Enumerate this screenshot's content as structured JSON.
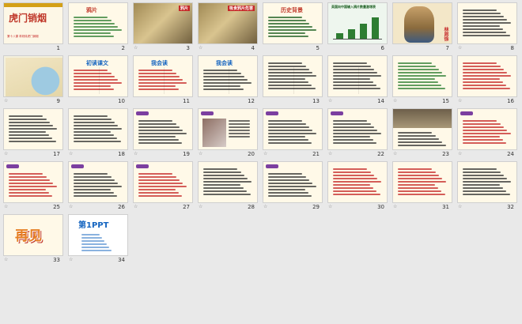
{
  "view": "slide-sorter",
  "slides": [
    {
      "num": "1",
      "kind": "title",
      "title": "虎门销烟",
      "subtitle": "第十八课 林则徐虎门销烟",
      "title_color": "#c0392b",
      "bg": "#fdf7e6"
    },
    {
      "num": "2",
      "kind": "text",
      "title": "鸦片",
      "title_color": "#c0392b",
      "bg": "#fff9e8",
      "line_color": "#2e7d32"
    },
    {
      "num": "3",
      "kind": "photo",
      "title": "鸦片",
      "bg": "#d8c9a0"
    },
    {
      "num": "4",
      "kind": "photo",
      "title": "吸食鸦片危害",
      "bg": "#bfb59a"
    },
    {
      "num": "5",
      "kind": "text",
      "title": "历史背景",
      "title_color": "#c0392b",
      "bg": "#fff9e8",
      "line_color": "#1b5e20"
    },
    {
      "num": "6",
      "kind": "chart",
      "title": "英国向中国输入鸦片数量激增表",
      "bg": "#eef6ee",
      "bar_values": [
        20,
        35,
        55,
        80
      ]
    },
    {
      "num": "7",
      "kind": "portrait",
      "title": "林则徐",
      "bg": "#f3e7c8"
    },
    {
      "num": "8",
      "kind": "text",
      "title": "",
      "bg": "#fff9e8",
      "line_color": "#333333"
    },
    {
      "num": "9",
      "kind": "map",
      "title": "",
      "bg": "#f4f0dc"
    },
    {
      "num": "10",
      "kind": "list",
      "title": "初读课文",
      "title_color": "#1565c0",
      "bg": "#fff9e8",
      "line_color": "#c62828"
    },
    {
      "num": "11",
      "kind": "list",
      "title": "我会读",
      "title_color": "#1565c0",
      "bg": "#fff9e8",
      "line_color": "#c62828"
    },
    {
      "num": "12",
      "kind": "list",
      "title": "我会读",
      "title_color": "#1565c0",
      "bg": "#fff9e8",
      "line_color": "#333333"
    },
    {
      "num": "13",
      "kind": "list",
      "title": "",
      "bg": "#fff9e8",
      "line_color": "#333333"
    },
    {
      "num": "14",
      "kind": "list",
      "title": "",
      "bg": "#fff9e8",
      "line_color": "#333333"
    },
    {
      "num": "15",
      "kind": "text",
      "title": "",
      "bg": "#fff9e8",
      "line_color": "#2e7d32"
    },
    {
      "num": "16",
      "kind": "text",
      "title": "",
      "bg": "#fff9e8",
      "line_color": "#c62828"
    },
    {
      "num": "17",
      "kind": "text",
      "title": "",
      "bg": "#fff9e8",
      "line_color": "#333333"
    },
    {
      "num": "18",
      "kind": "text",
      "title": "",
      "bg": "#fff9e8",
      "line_color": "#333333"
    },
    {
      "num": "19",
      "kind": "tagged",
      "title": "",
      "bg": "#fff9e8",
      "line_color": "#333333"
    },
    {
      "num": "20",
      "kind": "tagged-photo",
      "title": "",
      "bg": "#fff9e8",
      "line_color": "#333333"
    },
    {
      "num": "21",
      "kind": "tagged",
      "title": "",
      "bg": "#fff9e8",
      "line_color": "#333333"
    },
    {
      "num": "22",
      "kind": "tagged",
      "title": "",
      "bg": "#fff9e8",
      "line_color": "#333333"
    },
    {
      "num": "23",
      "kind": "photo-text",
      "title": "",
      "bg": "#fff9e8",
      "line_color": "#333333"
    },
    {
      "num": "24",
      "kind": "tagged",
      "title": "",
      "bg": "#fff9e8",
      "line_color": "#c62828"
    },
    {
      "num": "25",
      "kind": "tagged",
      "title": "",
      "bg": "#fff9e8",
      "line_color": "#c62828"
    },
    {
      "num": "26",
      "kind": "tagged",
      "title": "",
      "bg": "#fff9e8",
      "line_color": "#333333"
    },
    {
      "num": "27",
      "kind": "tagged",
      "title": "",
      "bg": "#fff9e8",
      "line_color": "#c62828"
    },
    {
      "num": "28",
      "kind": "text",
      "title": "",
      "bg": "#fff9e8",
      "line_color": "#333333"
    },
    {
      "num": "29",
      "kind": "tagged",
      "title": "",
      "bg": "#fff9e8",
      "line_color": "#333333"
    },
    {
      "num": "30",
      "kind": "text",
      "title": "",
      "bg": "#fff9e8",
      "line_color": "#c62828"
    },
    {
      "num": "31",
      "kind": "text",
      "title": "",
      "bg": "#fff9e8",
      "line_color": "#c62828"
    },
    {
      "num": "32",
      "kind": "text",
      "title": "",
      "bg": "#fff9e8",
      "line_color": "#333333"
    },
    {
      "num": "33",
      "kind": "end",
      "title": "再见",
      "title_color": "#e67e22",
      "bg": "#fff9e8"
    },
    {
      "num": "34",
      "kind": "brand",
      "title": "第1PPT",
      "title_color": "#1565c0",
      "bg": "#ffffff"
    }
  ]
}
